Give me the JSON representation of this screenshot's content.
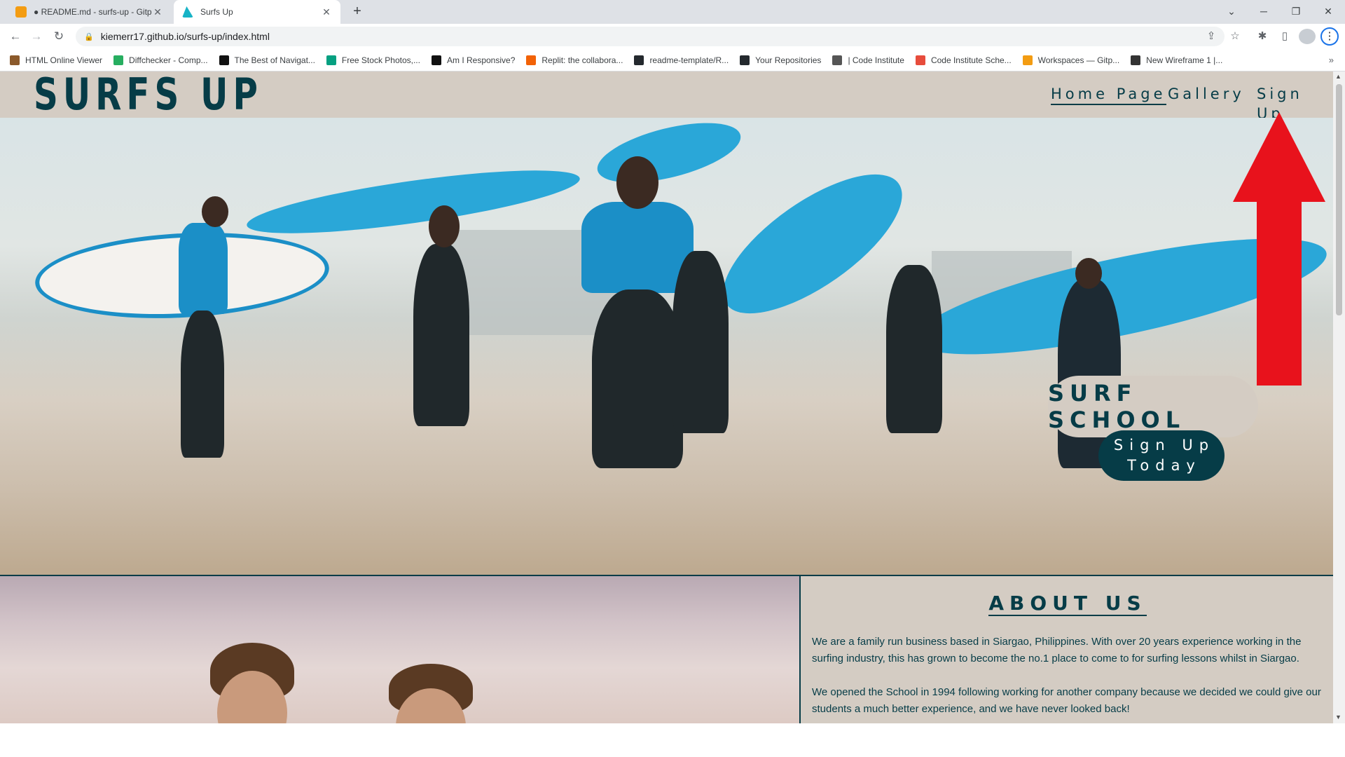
{
  "browser": {
    "tabs": [
      {
        "title": "● README.md - surfs-up - Gitpo",
        "active": false,
        "favicon_color": "#f39c12"
      },
      {
        "title": "Surfs Up",
        "active": true,
        "favicon_color": "#17b3c6"
      }
    ],
    "close_glyph": "✕",
    "new_tab_glyph": "+",
    "url": "kiemerr17.github.io/surfs-up/index.html",
    "bookmarks": [
      {
        "label": "HTML Online Viewer",
        "color": "#8b5a2b"
      },
      {
        "label": "Diffchecker - Comp...",
        "color": "#27ae60"
      },
      {
        "label": "The Best of Navigat...",
        "color": "#111111"
      },
      {
        "label": "Free Stock Photos,...",
        "color": "#05a081"
      },
      {
        "label": "Am I Responsive?",
        "color": "#111111"
      },
      {
        "label": "Replit: the collabora...",
        "color": "#f26207"
      },
      {
        "label": "readme-template/R...",
        "color": "#24292e"
      },
      {
        "label": "Your Repositories",
        "color": "#24292e"
      },
      {
        "label": "| Code Institute",
        "color": "#555555"
      },
      {
        "label": "Code Institute Sche...",
        "color": "#e74c3c"
      },
      {
        "label": "Workspaces — Gitp...",
        "color": "#f39c12"
      },
      {
        "label": "New Wireframe 1 |...",
        "color": "#333333"
      }
    ],
    "bookmarks_more": "»"
  },
  "site": {
    "logo": "SURFS UP",
    "nav": [
      {
        "label": "Home Page",
        "active": true
      },
      {
        "label": "Gallery",
        "active": false
      },
      {
        "label": "Sign Up",
        "active": false
      }
    ],
    "hero": {
      "heading": "SURF SCHOOL",
      "cta_line1": "Sign Up",
      "cta_line2": "Today"
    },
    "about": {
      "heading": "ABOUT US",
      "paragraph1": "We are a family run business based in Siargao, Philippines. With over 20 years experience working in the surfing industry, this has grown to become the no.1 place to come to for surfing lessons whilst in Siargao.",
      "paragraph2": "We opened the School in 1994 following working for another company because we decided we could give our students a much better experience, and we have never looked back!"
    },
    "colors": {
      "brand_dark": "#063c47",
      "header_bg": "#d4ccc3",
      "annotation_arrow": "#e8121c"
    }
  }
}
